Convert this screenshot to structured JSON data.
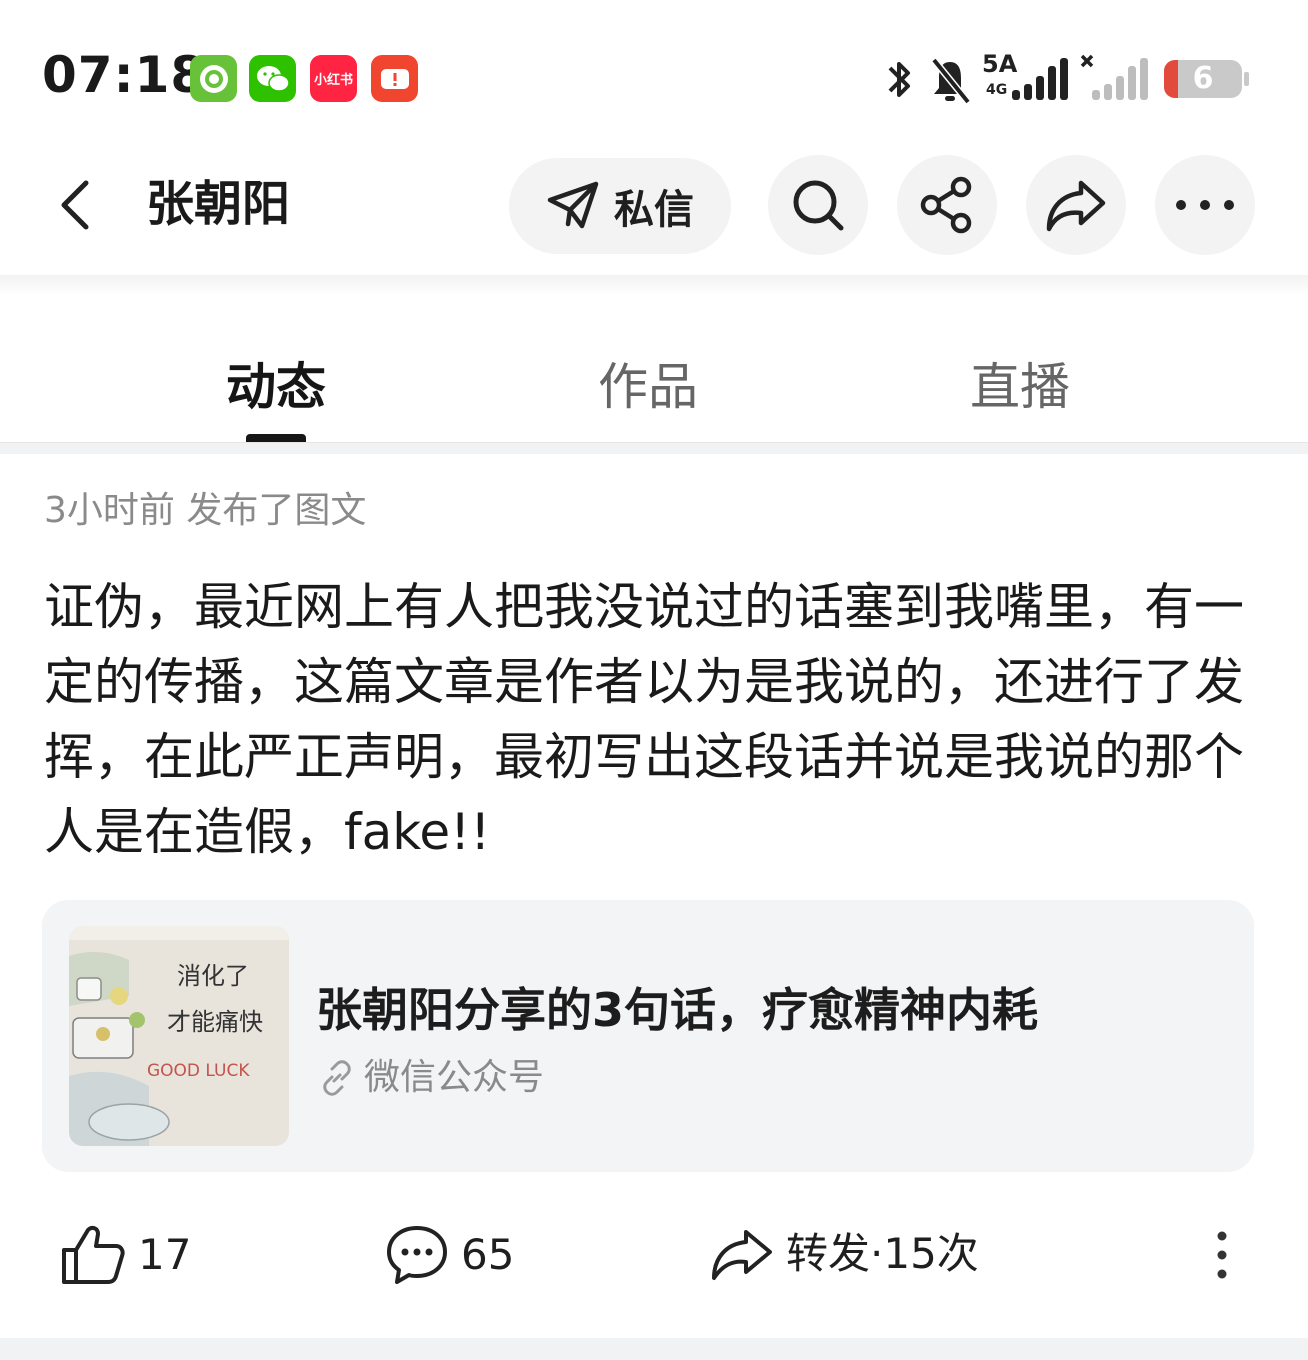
{
  "status_bar": {
    "time": "07:18",
    "app_icons": [
      "green-app-icon",
      "wechat-icon",
      "xiaohongshu-icon",
      "red-app-icon"
    ],
    "xiaohongshu_label": "小红书",
    "network_label": "5A",
    "network_sub": "4G",
    "battery_level": "6",
    "battery_fraction": 0.06,
    "colors": {
      "battery_low": "#e24a3e"
    }
  },
  "header": {
    "name": "张朝阳",
    "private_message_label": "私信",
    "icons": [
      "back-icon",
      "send-icon",
      "search-icon",
      "share-icon",
      "forward-icon",
      "more-icon"
    ]
  },
  "tabs": [
    {
      "label": "动态",
      "active": true
    },
    {
      "label": "作品",
      "active": false
    },
    {
      "label": "直播",
      "active": false
    }
  ],
  "post": {
    "meta": "3小时前 发布了图文",
    "body": "证伪，最近网上有人把我没说过的话塞到我嘴里，有一定的传播，这篇文章是作者以为是我说的，还进行了发挥，在此严正声明，最初写出这段话并说是我说的那个人是在造假，fake!!",
    "link": {
      "title": "张朝阳分享的3句话，疗愈精神内耗",
      "source": "微信公众号",
      "thumbnail_text": [
        "消化了",
        "才能痛快",
        "GOOD LUCK"
      ]
    }
  },
  "actions": {
    "likes": "17",
    "comments": "65",
    "repost_label": "转发·15次"
  }
}
